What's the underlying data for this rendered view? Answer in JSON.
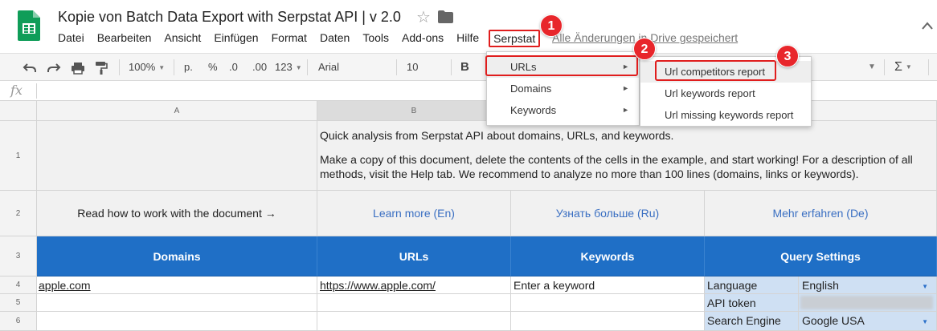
{
  "app": {
    "doc_title": "Kopie von Batch Data Export with Serpstat API |  v 2.0",
    "save_status": "Alle Änderungen in Drive gespeichert",
    "brand_color": "#0f9d58"
  },
  "menubar": {
    "items": [
      "Datei",
      "Bearbeiten",
      "Ansicht",
      "Einfügen",
      "Format",
      "Daten",
      "Tools",
      "Add-ons",
      "Hilfe"
    ],
    "serpstat": "Serpstat"
  },
  "toolbar": {
    "zoom": "100%",
    "currency": "р.",
    "percent": "%",
    "decrease_decimals": ".0",
    "increase_decimals": ".00",
    "number_format": "123",
    "font": "Arial",
    "font_size": "10",
    "bold": "B",
    "sigma": "Σ"
  },
  "formula_bar": {
    "fx": "fx",
    "value": ""
  },
  "columns": [
    "A",
    "B"
  ],
  "rows": [
    "1",
    "2",
    "3",
    "4",
    "5",
    "6"
  ],
  "cells": {
    "b1_line1": "Quick analysis from Serpstat API about domains, URLs, and keywords.",
    "b1_line2": "Make a copy of this document, delete the contents of the cells in the example, and start working! For a description of all methods, visit the Help tab. We recommend to analyze no more than 100 lines (domains, links or keywords).",
    "a2": "Read how to work with the document →",
    "b2": "Learn more (En)",
    "c2": "Узнать больше (Ru)",
    "d2": "Mehr erfahren (De)",
    "a3": "Domains",
    "b3": "URLs",
    "c3": "Keywords",
    "d3": "Query Settings",
    "a4": "apple.com",
    "b4": "https://www.apple.com/",
    "c4": "Enter a keyword",
    "d4": "Language",
    "e4": "English",
    "d5": "API token",
    "d6": "Search Engine",
    "e6": "Google USA"
  },
  "serpstat_menu": {
    "items": [
      "URLs",
      "Domains",
      "Keywords"
    ]
  },
  "urls_submenu": {
    "items": [
      "Url competitors report",
      "Url keywords report",
      "Url missing keywords report"
    ]
  },
  "annotations": {
    "badges": [
      "1",
      "2",
      "3"
    ],
    "color": "#e01d1d"
  }
}
